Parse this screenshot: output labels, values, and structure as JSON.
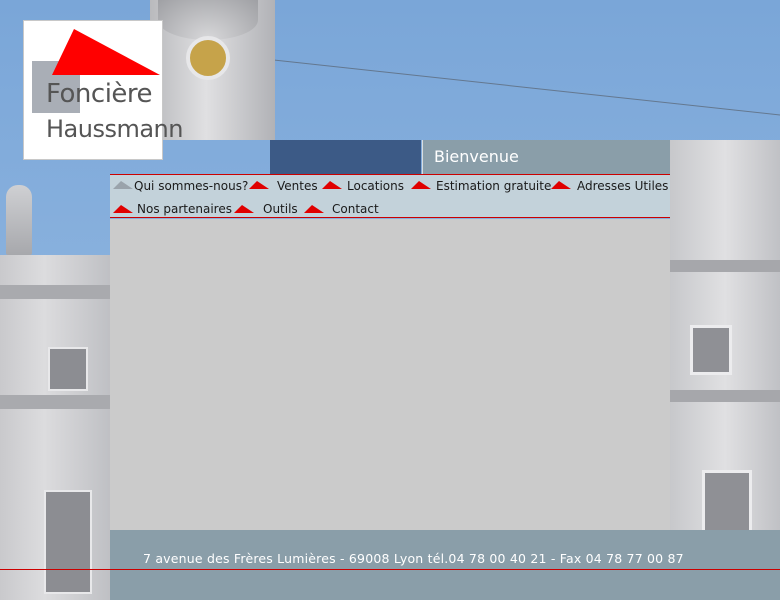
{
  "logo": {
    "line1": "Foncière",
    "line2": "Haussmann"
  },
  "header": {
    "title": "Bienvenue"
  },
  "menu": {
    "items": [
      {
        "label": "Qui sommes-nous?",
        "active": true
      },
      {
        "label": "Ventes"
      },
      {
        "label": "Locations"
      },
      {
        "label": "Estimation gratuite"
      },
      {
        "label": "Adresses Utiles"
      },
      {
        "label": "Nos partenaires"
      },
      {
        "label": "Outils"
      },
      {
        "label": "Contact"
      }
    ]
  },
  "footer": {
    "text": "7 avenue des Frères Lumières - 69008 Lyon  tél.04 78 00 40 21  - Fax 04 78 77 00 87"
  },
  "colors": {
    "accent": "#e00000",
    "header_blue": "#3c5a86",
    "header_grey": "#8a9ea9",
    "menu_bg": "#c3d2da",
    "content_bg": "#cbcbcb"
  }
}
